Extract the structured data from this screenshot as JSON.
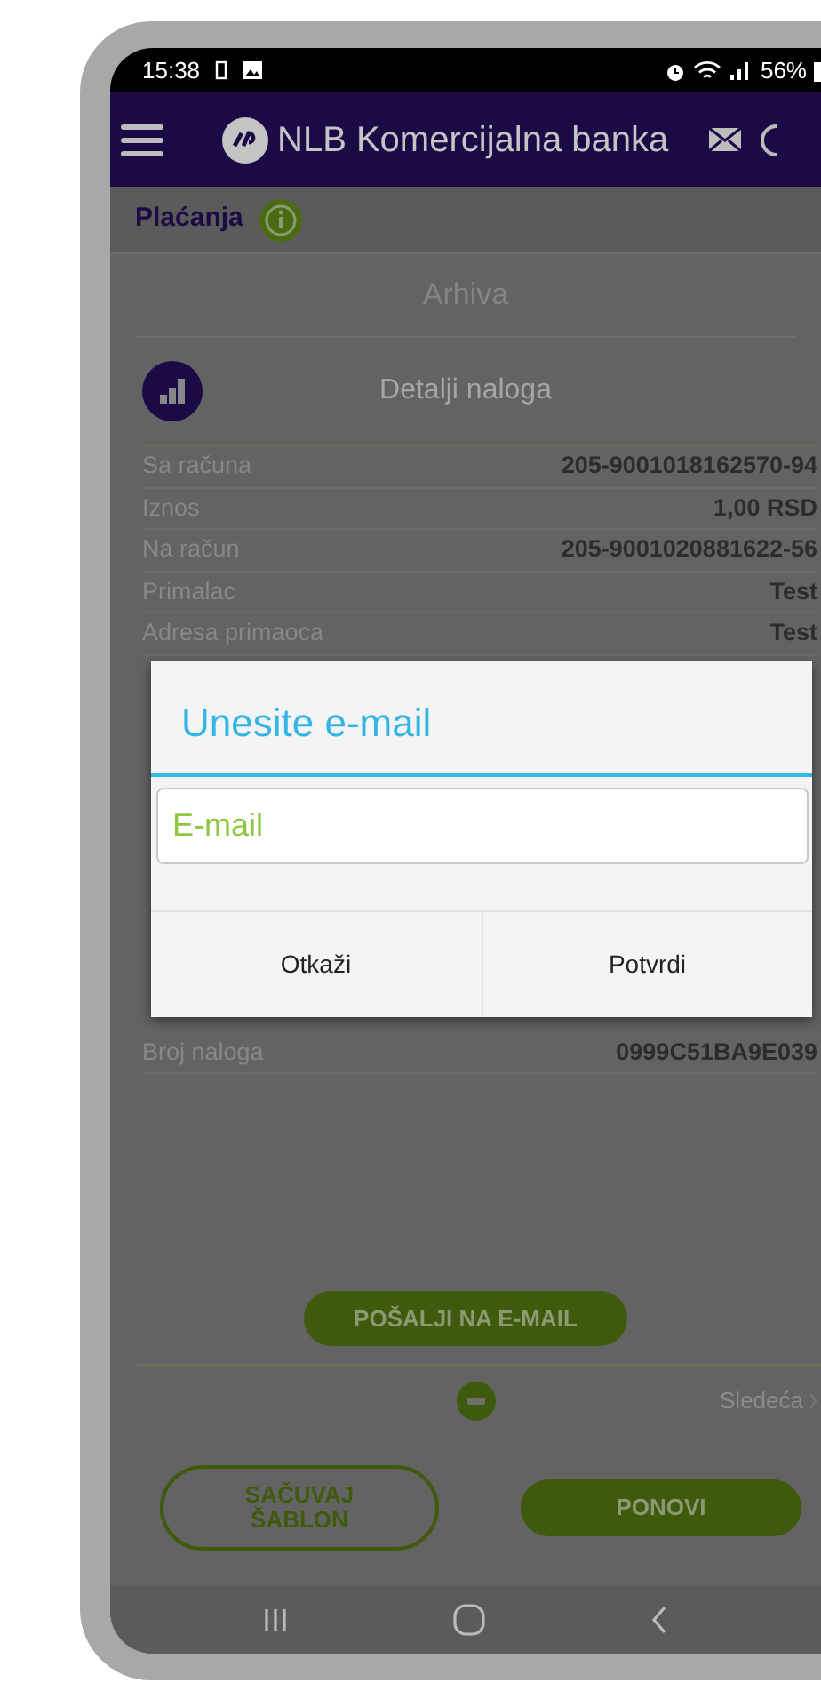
{
  "status_bar": {
    "time": "15:38",
    "battery": "56%"
  },
  "app_bar": {
    "title": "NLB Komercijalna banka"
  },
  "section": {
    "title": "Plaćanja"
  },
  "tab": {
    "label": "Arhiva"
  },
  "details": {
    "title": "Detalji naloga",
    "rows_above": [
      {
        "label": "Sa računa",
        "value": "205-9001018162570-94"
      },
      {
        "label": "Iznos",
        "value": "1,00 RSD"
      },
      {
        "label": "Na račun",
        "value": "205-9001020881622-56"
      },
      {
        "label": "Primalac",
        "value": "Test"
      },
      {
        "label": "Adresa primaoca",
        "value": "Test"
      }
    ],
    "rows_below": [
      {
        "label": "Broj naloga",
        "value": "0999C51BA9E039"
      }
    ]
  },
  "actions": {
    "send_button": "POŠALJI NA E-MAIL",
    "next_link": "Sledeća",
    "buttons": [
      {
        "label": "SAČUVAJ ŠABLON",
        "kind": "outline"
      },
      {
        "label": "PONOVI",
        "kind": "filled"
      }
    ]
  },
  "dialog": {
    "title": "Unesite e-mail",
    "field": {
      "placeholder": "E-mail"
    },
    "buttons": [
      "Otkaži",
      "Potvrdi"
    ]
  }
}
